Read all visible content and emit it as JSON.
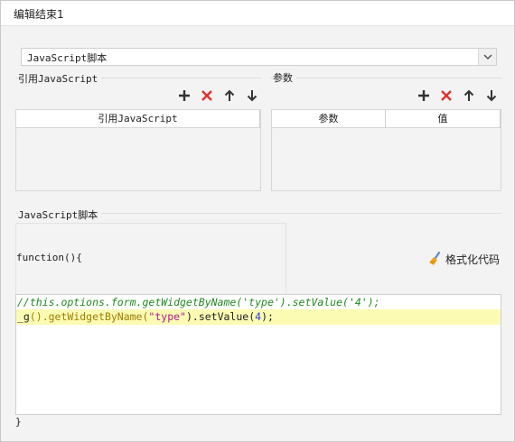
{
  "window": {
    "title": "编辑结束1"
  },
  "script_type": {
    "selected": "JavaScript脚本"
  },
  "ref_group": {
    "label": "引用JavaScript",
    "columns": [
      "引用JavaScript"
    ]
  },
  "param_group": {
    "label": "参数",
    "columns": [
      "参数",
      "值"
    ]
  },
  "script_group": {
    "label": "JavaScript脚本",
    "function_header": "function(){",
    "closing_brace": "}",
    "format_button": "格式化代码"
  },
  "code": {
    "line1": "//this.options.form.getWidgetByName('type').setValue('4');",
    "line2_a": "_g",
    "line2_b": "().getWidgetByName(",
    "line2_str": "\"type\"",
    "line2_c": ").setValue(",
    "line2_num": "4",
    "line2_d": ");"
  },
  "colors": {
    "add": "#333333",
    "delete": "#e0312e",
    "arrow": "#333333",
    "comment": "#218a21",
    "highlight": "#fbfbb4"
  },
  "icons": [
    "plus-icon",
    "delete-x-icon",
    "arrow-up-icon",
    "arrow-down-icon",
    "chevron-down-icon",
    "broom-icon"
  ]
}
